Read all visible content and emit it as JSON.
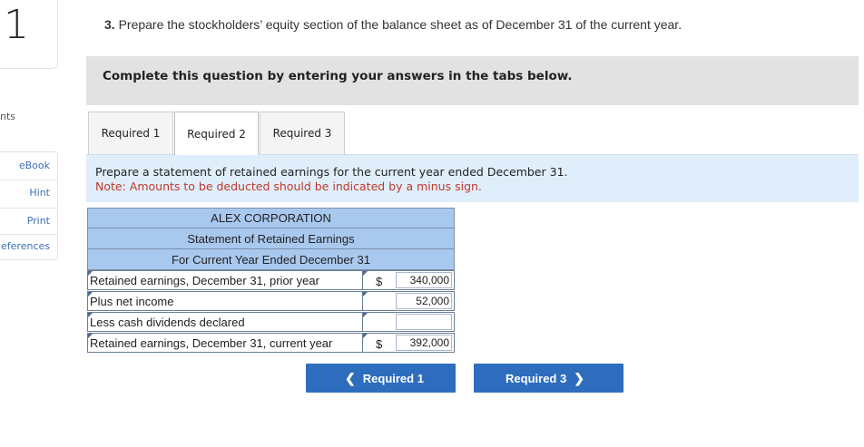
{
  "question_number": "1",
  "points_label": "nts",
  "sidebar": {
    "items": [
      {
        "label": "eBook"
      },
      {
        "label": "Hint"
      },
      {
        "label": "Print"
      },
      {
        "label": "eferences"
      }
    ]
  },
  "question": {
    "number": "3.",
    "text": "Prepare the stockholders’ equity section of the balance sheet as of December 31 of the current year."
  },
  "banner_text": "Complete this question by entering your answers in the tabs below.",
  "tabs": [
    {
      "label": "Required 1",
      "active": false
    },
    {
      "label": "Required 2",
      "active": true
    },
    {
      "label": "Required 3",
      "active": false
    }
  ],
  "instructions": {
    "line1": "Prepare a statement of retained earnings for the  current year ended December 31.",
    "line2": "Note: Amounts to be deducted should be indicated by a minus sign."
  },
  "statement": {
    "company": "ALEX CORPORATION",
    "title": "Statement of Retained Earnings",
    "period": "For Current Year Ended December 31",
    "rows": [
      {
        "label": "Retained earnings, December 31, prior year",
        "currency": "$",
        "amount": "340,000"
      },
      {
        "label": "Plus net income",
        "currency": "",
        "amount": "52,000"
      },
      {
        "label": "Less cash dividends declared",
        "currency": "",
        "amount": ""
      },
      {
        "label": "Retained earnings, December 31, current year",
        "currency": "$",
        "amount": "392,000"
      }
    ]
  },
  "nav": {
    "prev_label": "Required 1",
    "next_label": "Required 3"
  },
  "colors": {
    "accent": "#2e6dbd",
    "table_header": "#a9c8ee",
    "instruction_bg": "#dfeefa",
    "note_red": "#c0392b"
  }
}
